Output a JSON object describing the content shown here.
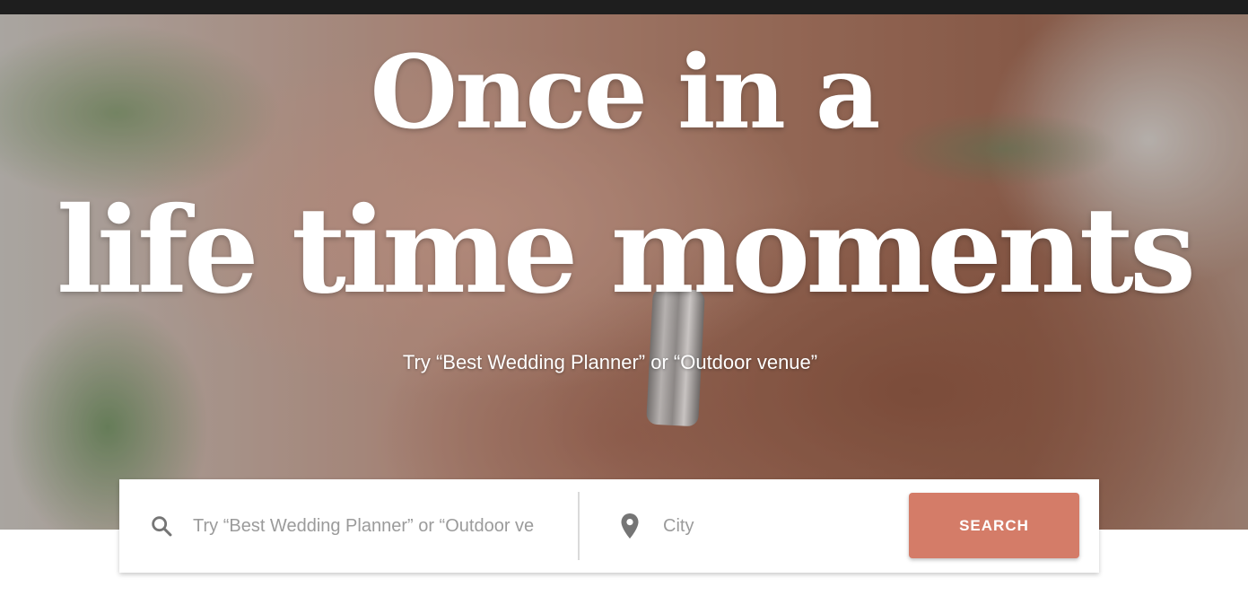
{
  "hero": {
    "headline_line1": "Once in a",
    "headline_line2": "life time moments",
    "tagline": "Try “Best Wedding Planner” or “Outdoor venue”"
  },
  "search": {
    "query_placeholder": "Try “Best Wedding Planner” or “Outdoor venue”",
    "query_value": "",
    "city_placeholder": "City",
    "city_value": "",
    "button_label": "SEARCH",
    "icons": {
      "query": "search-icon",
      "city": "location-pin-icon"
    }
  },
  "colors": {
    "button": "#d47c68",
    "topbar": "#1e1e1e",
    "icon": "#757575"
  }
}
